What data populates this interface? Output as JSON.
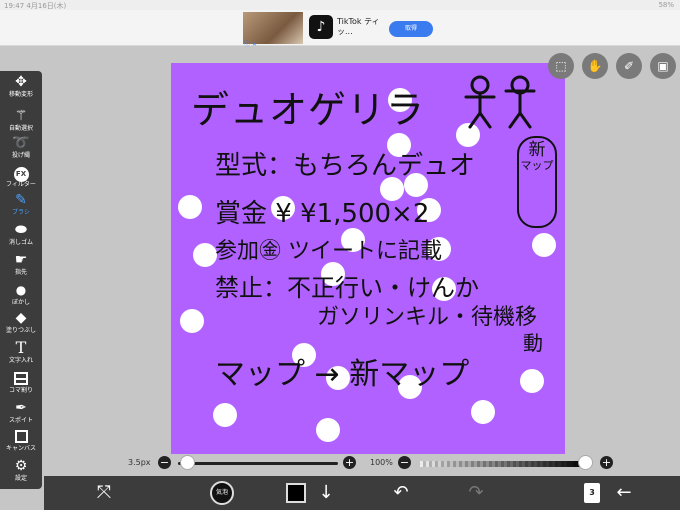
{
  "status": {
    "time": "19:47",
    "date": "4月16日(木)",
    "battery": "58%"
  },
  "ad": {
    "app_name": "TikTok ティッ...",
    "button": "取得",
    "info": "ⓘ ✕",
    "logo": "♪"
  },
  "toolbar": {
    "tools": [
      {
        "label": "移動変形",
        "icon": "move-icon",
        "glyph": "✥"
      },
      {
        "label": "自動選択",
        "icon": "magic-wand-icon",
        "glyph": "⚚"
      },
      {
        "label": "投げ縄",
        "icon": "lasso-icon",
        "glyph": "➰"
      },
      {
        "label": "フィルター",
        "icon": "fx-icon",
        "glyph": "FX"
      },
      {
        "label": "ブラシ",
        "icon": "brush-icon",
        "glyph": "✎"
      },
      {
        "label": "消しゴム",
        "icon": "eraser-icon",
        "glyph": "⬬"
      },
      {
        "label": "指先",
        "icon": "finger-icon",
        "glyph": "☛"
      },
      {
        "label": "ぼかし",
        "icon": "blur-icon",
        "glyph": "💧"
      },
      {
        "label": "塗りつぶし",
        "icon": "fill-icon",
        "glyph": "◆"
      },
      {
        "label": "文字入れ",
        "icon": "text-icon",
        "glyph": "T"
      },
      {
        "label": "コマ割り",
        "icon": "frame-divide-icon",
        "glyph": ""
      },
      {
        "label": "スポイト",
        "icon": "eyedropper-icon",
        "glyph": "✒"
      },
      {
        "label": "キャンバス",
        "icon": "canvas-icon",
        "glyph": ""
      },
      {
        "label": "設定",
        "icon": "gear-icon",
        "glyph": "⚙"
      }
    ],
    "active_index": 4
  },
  "canvas": {
    "background": "#b061ff",
    "title": "デュオゲリラ",
    "lines": [
      "型式：もちろんデュオ",
      "賞金 ¥ ¥1,500×2",
      "参加㊎ ツイートに記載",
      "禁止：不正行い・けんか",
      "ガソリンキル・待機移",
      "動",
      "マップ → 新マップ"
    ],
    "bubble_text": "新",
    "bubble_sub": "マップ"
  },
  "top_buttons": [
    {
      "name": "selection-icon",
      "glyph": "⬚"
    },
    {
      "name": "hand-icon",
      "glyph": "✋"
    },
    {
      "name": "pen-icon",
      "glyph": "✐"
    },
    {
      "name": "image-icon",
      "glyph": "▣"
    }
  ],
  "brush_size": {
    "label": "3.5px",
    "value_fraction": 0.01,
    "minus": "−",
    "plus": "+"
  },
  "opacity": {
    "label": "100%",
    "value_fraction": 1.0,
    "minus": "−",
    "plus": "+"
  },
  "bottom_bar": {
    "items": [
      {
        "name": "transform-icon",
        "glyph": "⤧"
      },
      {
        "name": "down-arrow-icon",
        "glyph": "↓"
      },
      {
        "name": "undo-icon",
        "glyph": "↶"
      },
      {
        "name": "redo-icon",
        "glyph": "↷"
      },
      {
        "name": "back-arrow-icon",
        "glyph": "←"
      }
    ],
    "brush_preview_label": "気泡",
    "color": "#000000",
    "layer_count": "3"
  }
}
